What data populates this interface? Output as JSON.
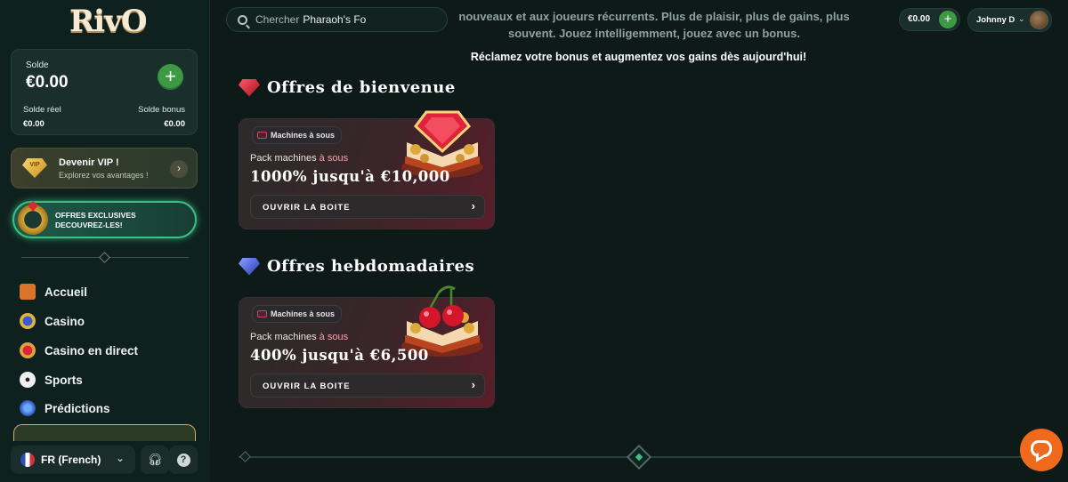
{
  "brand": {
    "logo": "RivO"
  },
  "balance": {
    "label": "Solde",
    "amount": "€0.00",
    "real_label": "Solde réel",
    "real_value": "€0.00",
    "bonus_label": "Solde bonus",
    "bonus_value": "€0.00"
  },
  "vip": {
    "title": "Devenir VIP !",
    "subtitle": "Explorez vos avantages !",
    "badge": "VIP"
  },
  "offers_banner": {
    "line1": "OFFRES EXCLUSIVES",
    "line2": "DECOUVREZ-LES!"
  },
  "nav": [
    {
      "label": "Accueil",
      "icon": "home-ticket-icon"
    },
    {
      "label": "Casino",
      "icon": "casino-chip-icon"
    },
    {
      "label": "Casino en direct",
      "icon": "live-casino-icon"
    },
    {
      "label": "Sports",
      "icon": "soccer-ball-icon"
    },
    {
      "label": "Prédictions",
      "icon": "predictions-icon"
    }
  ],
  "language": {
    "label": "FR (French)"
  },
  "search": {
    "placeholder": "Chercher",
    "value": "Pharaoh's Fo"
  },
  "header": {
    "intro_partial": "nouveaux et aux joueurs récurrents. Plus de plaisir, plus de gains, plus souvent. Jouez intelligemment, jouez avec un bonus.",
    "tagline": "Réclamez votre bonus et augmentez vos gains dès aujourd'hui!",
    "wallet": "€0.00",
    "user": "Johnny D"
  },
  "sections": [
    {
      "title": "Offres de bienvenue",
      "gem_color": "#e0223a",
      "card": {
        "tag": "Machines à sous",
        "pack_prefix": "Pack machines ",
        "pack_highlight": "à sous",
        "headline": "1000% jusqu'à €10,000",
        "button": "OUVRIR LA BOITE",
        "art": "ruby-book"
      }
    },
    {
      "title": "Offres hebdomadaires",
      "gem_color": "#3d54e0",
      "card": {
        "tag": "Machines à sous",
        "pack_prefix": "Pack machines ",
        "pack_highlight": "à sous",
        "headline": "400% jusqu'à €6,500",
        "button": "OUVRIR LA BOITE",
        "art": "cherry-book"
      }
    }
  ]
}
